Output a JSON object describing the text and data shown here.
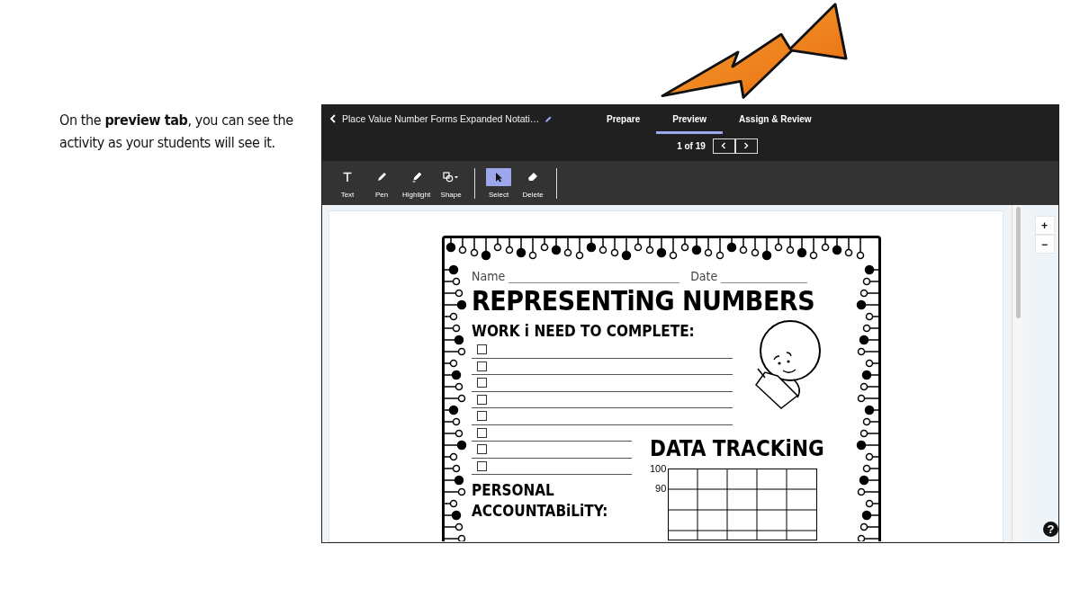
{
  "caption": "On the **preview tab**, you can see the activity as your students will see it.",
  "app": {
    "title": "Place Value Number Forms Expanded Notati…",
    "tabs": [
      {
        "label": "Prepare",
        "selected": false
      },
      {
        "label": "Preview",
        "selected": true
      },
      {
        "label": "Assign & Review",
        "selected": false
      }
    ],
    "pager": "1 of 19",
    "tools": [
      {
        "kind": "text",
        "label": "Text",
        "selected": false
      },
      {
        "kind": "pen",
        "label": "Pen",
        "selected": false
      },
      {
        "kind": "highlight",
        "label": "Highlight",
        "selected": false
      },
      {
        "kind": "shape",
        "label": "Shape",
        "selected": false
      },
      {
        "kind": "separator"
      },
      {
        "kind": "select",
        "label": "Select",
        "selected": true
      },
      {
        "kind": "delete",
        "label": "Delete",
        "selected": false
      },
      {
        "kind": "separator"
      }
    ],
    "zoom": [
      "+",
      "−"
    ],
    "help": "?",
    "worksheet": {
      "name_label": "Name",
      "date_label": "Date",
      "title": "REPRESENTiNG NUMBERS",
      "work_heading": "WORK i NEED TO COMPLETE:",
      "tasks": [
        {
          "checked": false
        },
        {
          "checked": false
        },
        {
          "checked": false
        },
        {
          "checked": false
        },
        {
          "checked": false
        },
        {
          "checked": false
        },
        {
          "checked": false
        },
        {
          "checked": false
        }
      ],
      "accountability_heading": "PERSONAL ACCOUNTABiLiTY:",
      "tracking_heading": "DATA TRACKiNG",
      "tracking_labels": [
        "100",
        "90"
      ]
    }
  }
}
